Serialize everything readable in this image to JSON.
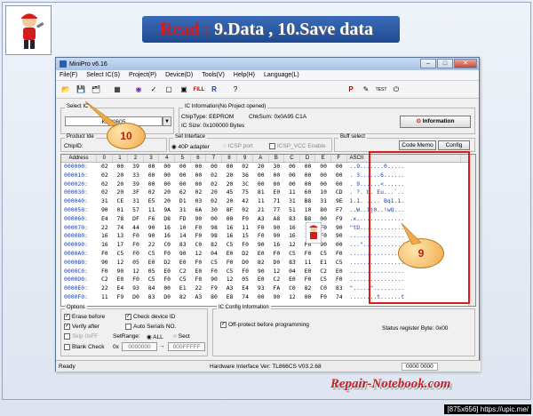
{
  "slide": {
    "title_red": "Read :",
    "title_white": " 9.Data , 10.Save data",
    "brand": "Repair-Notebook.com",
    "watermark": "[875x656] https://upic.me/"
  },
  "window": {
    "title": "MiniPro v6.16",
    "min": "–",
    "max": "□",
    "close": "✕"
  },
  "menu": [
    "File(F)",
    "Select IC(S)",
    "Project(P)",
    "Device(D)",
    "Tools(V)",
    "Help(H)",
    "Language(L)"
  ],
  "toolbar_icons": [
    "open-file-icon",
    "save-icon",
    "save-project-icon",
    "select-ic-icon",
    "read-icon",
    "verify-icon",
    "blank-check-icon",
    "program-icon",
    "fill-icon",
    "read-id-icon",
    "help-icon",
    "pause-icon",
    "edit-icon",
    "test-icon",
    "exit-icon"
  ],
  "select_ic": {
    "label": "Select IC",
    "value": "KB90605"
  },
  "ic_info": {
    "label": "IC Information(No Project opened)",
    "chip_type": "ChipType:  EEPROM",
    "chksum": "ChkSum: 0x0A95 C1A",
    "ic_size": "IC Size:   0x100000 Bytes",
    "information_btn": "Information"
  },
  "product_id": {
    "label": "Product Ide",
    "chip_id": "ChipID:"
  },
  "set_interface": {
    "label": "Set Interface",
    "opt1": "40P adapter",
    "opt2": "ICSP port",
    "opt3": "ICSP_VCC Enable"
  },
  "buff_select": {
    "label": "Buff select",
    "code_memo": "Code Memo",
    "config": "Config"
  },
  "hex": {
    "headers": [
      "Address",
      "0",
      "1",
      "2",
      "3",
      "4",
      "5",
      "6",
      "7",
      "8",
      "9",
      "A",
      "B",
      "C",
      "D",
      "E",
      "F",
      "ASCII"
    ],
    "rows": [
      {
        "addr": "000000:",
        "bytes": [
          "02",
          "00",
          "39",
          "00",
          "00",
          "00",
          "00",
          "00",
          "00",
          "02",
          "20",
          "30",
          "00",
          "00",
          "00",
          "00"
        ],
        "ascii": "..9.......0....."
      },
      {
        "addr": "000010:",
        "bytes": [
          "02",
          "20",
          "33",
          "00",
          "00",
          "00",
          "00",
          "02",
          "20",
          "36",
          "00",
          "00",
          "00",
          "00",
          "00",
          "00"
        ],
        "ascii": ". 3......6......"
      },
      {
        "addr": "000020:",
        "bytes": [
          "02",
          "20",
          "39",
          "00",
          "00",
          "00",
          "00",
          "02",
          "20",
          "3C",
          "00",
          "00",
          "00",
          "00",
          "00",
          "00"
        ],
        "ascii": ". 9......<......"
      },
      {
        "addr": "000030:",
        "bytes": [
          "02",
          "20",
          "3F",
          "02",
          "20",
          "62",
          "02",
          "20",
          "45",
          "75",
          "81",
          "E0",
          "11",
          "60",
          "10",
          "CD"
        ],
        "ascii": ". ?. b. Eu...`.."
      },
      {
        "addr": "000040:",
        "bytes": [
          "31",
          "CE",
          "31",
          "E5",
          "20",
          "D1",
          "03",
          "02",
          "20",
          "42",
          "11",
          "71",
          "31",
          "B8",
          "31",
          "9E"
        ],
        "ascii": "1.1. .... Bq1.1."
      },
      {
        "addr": "000050:",
        "bytes": [
          "90",
          "01",
          "57",
          "11",
          "9A",
          "31",
          "6A",
          "30",
          "8F",
          "02",
          "21",
          "77",
          "51",
          "10",
          "80",
          "F7"
        ],
        "ascii": "..W..1j0..!wQ..."
      },
      {
        "addr": "000060:",
        "bytes": [
          "E4",
          "78",
          "DF",
          "F6",
          "D8",
          "FD",
          "90",
          "00",
          "00",
          "F0",
          "A3",
          "A8",
          "83",
          "B8",
          "00",
          "F9"
        ],
        "ascii": ".x.............."
      },
      {
        "addr": "000070:",
        "bytes": [
          "22",
          "74",
          "44",
          "90",
          "16",
          "10",
          "F0",
          "98",
          "16",
          "11",
          "F0",
          "90",
          "16",
          "12",
          "F0",
          "90"
        ],
        "ascii": "\"tD............."
      },
      {
        "addr": "000080:",
        "bytes": [
          "16",
          "13",
          "F0",
          "90",
          "16",
          "14",
          "F0",
          "98",
          "16",
          "15",
          "F0",
          "90",
          "16",
          "16",
          "F0",
          "90"
        ],
        "ascii": "................"
      },
      {
        "addr": "000090:",
        "bytes": [
          "16",
          "17",
          "F0",
          "22",
          "C0",
          "83",
          "C0",
          "82",
          "C5",
          "F0",
          "90",
          "16",
          "12",
          "F0",
          "90",
          "00"
        ],
        "ascii": "...\"............"
      },
      {
        "addr": "0000A0:",
        "bytes": [
          "F0",
          "C5",
          "F0",
          "C5",
          "F0",
          "90",
          "12",
          "04",
          "E0",
          "D2",
          "E0",
          "F0",
          "C5",
          "F0",
          "C5",
          "F0"
        ],
        "ascii": "................"
      },
      {
        "addr": "0000B0:",
        "bytes": [
          "90",
          "12",
          "05",
          "E0",
          "D2",
          "E0",
          "F0",
          "C5",
          "F0",
          "D0",
          "82",
          "D0",
          "83",
          "11",
          "E1",
          "C5"
        ],
        "ascii": "................"
      },
      {
        "addr": "0000C0:",
        "bytes": [
          "F0",
          "90",
          "12",
          "05",
          "E0",
          "C2",
          "E0",
          "F0",
          "C5",
          "F0",
          "90",
          "12",
          "04",
          "E0",
          "C2",
          "E0"
        ],
        "ascii": "................"
      },
      {
        "addr": "0000D0:",
        "bytes": [
          "C2",
          "E0",
          "F0",
          "C5",
          "F0",
          "C5",
          "F0",
          "90",
          "12",
          "05",
          "E0",
          "C2",
          "E0",
          "F0",
          "C5",
          "F0"
        ],
        "ascii": "................"
      },
      {
        "addr": "0000E0:",
        "bytes": [
          "22",
          "E4",
          "93",
          "84",
          "00",
          "E1",
          "22",
          "F9",
          "A3",
          "E4",
          "93",
          "FA",
          "C0",
          "82",
          "C0",
          "83"
        ],
        "ascii": "\".....\"........."
      },
      {
        "addr": "0000F0:",
        "bytes": [
          "11",
          "F9",
          "D0",
          "83",
          "D0",
          "82",
          "A3",
          "80",
          "E8",
          "74",
          "00",
          "90",
          "12",
          "00",
          "F0",
          "74"
        ],
        "ascii": "........t......t"
      }
    ]
  },
  "options": {
    "label": "Options",
    "erase_before": "Erase before",
    "check_device_id": "Check device ID",
    "verify_after": "Verify after",
    "auto_serials": "Auto Serials NO.",
    "skip_0xff": "Skip 0xFF",
    "set_range": "SetRange:",
    "all": "ALL",
    "sect": "Sect",
    "blank_check": "Blank Check",
    "range_from": "0000000",
    "range_to": "000FFFFF",
    "ox": "0x"
  },
  "ic_config": {
    "label": "IC Config Information",
    "off_protect": "Off-protect before programming",
    "status_reg": "Status register Byte: 0x00"
  },
  "status_bar": {
    "ready": "Ready",
    "hw": "Hardware Interface Ver: TL866CS V03.2.68",
    "counter": "0000 0000"
  },
  "callouts": {
    "save": "10",
    "data": "9"
  }
}
